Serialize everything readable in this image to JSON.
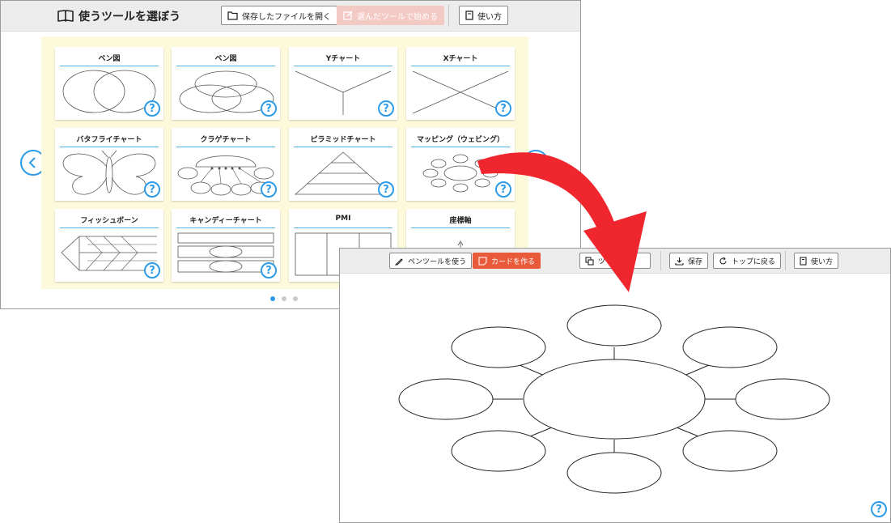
{
  "picker": {
    "title": "使うツールを選ぼう",
    "open_file_label": "保存したファイルを開く",
    "start_tool_label": "選んだツールで始める",
    "howto_label": "使い方",
    "cards": [
      {
        "title": "ベン図"
      },
      {
        "title": "ベン図"
      },
      {
        "title": "Yチャート"
      },
      {
        "title": "Xチャート"
      },
      {
        "title": "バタフライチャート"
      },
      {
        "title": "クラゲチャート"
      },
      {
        "title": "ピラミッドチャート"
      },
      {
        "title": "マッピング（ウェビング）"
      },
      {
        "title": "フィッシュボーン"
      },
      {
        "title": "キャンディーチャート"
      },
      {
        "title": "PMI"
      },
      {
        "title": "座標軸"
      }
    ],
    "pages": 3,
    "current_page": 1
  },
  "editor": {
    "pen_label": "ペンツールを使う",
    "card_label": "カードを作る",
    "hidden_label": "ツ",
    "save_label": "保存",
    "top_label": "トップに戻る",
    "howto_label": "使い方"
  },
  "help_glyph": "?",
  "colors": {
    "accent_blue": "#2d9be8",
    "accent_red": "#e85a3a",
    "arrow_red": "#f0262e",
    "grid_bg": "#fdf9db"
  }
}
